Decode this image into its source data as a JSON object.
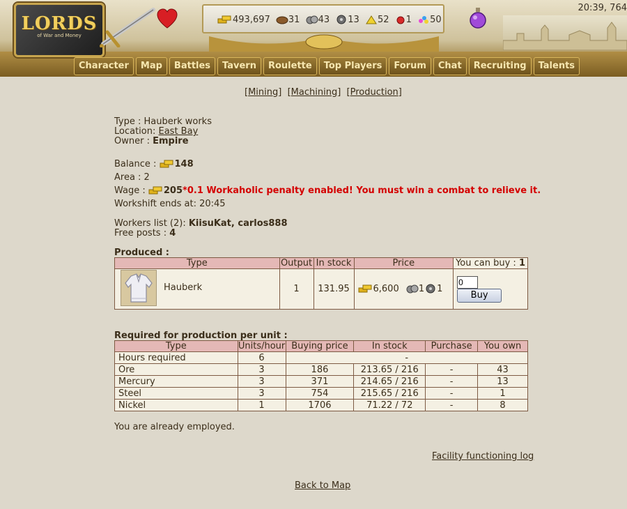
{
  "header": {
    "logo_title": "LORDS",
    "logo_subtitle": "of War and Money",
    "resources": [
      {
        "icon": "gold-icon",
        "value": "493,697"
      },
      {
        "icon": "wood-icon",
        "value": "31"
      },
      {
        "icon": "ore-icon",
        "value": "43"
      },
      {
        "icon": "mercury-icon",
        "value": "13"
      },
      {
        "icon": "sulfur-icon",
        "value": "52"
      },
      {
        "icon": "crystal-icon",
        "value": "1"
      },
      {
        "icon": "gems-icon",
        "value": "50"
      }
    ],
    "clock": "20:39, 764"
  },
  "nav": [
    "Character",
    "Map",
    "Battles",
    "Tavern",
    "Roulette",
    "Top Players",
    "Forum",
    "Chat",
    "Recruiting",
    "Talents"
  ],
  "subnav": [
    "Mining",
    "Machining",
    "Production"
  ],
  "facility": {
    "type_label": "Type : ",
    "type_value": "Hauberk works",
    "location_label": "Location: ",
    "location_value": "East Bay",
    "owner_label": "Owner : ",
    "owner_value": "Empire",
    "balance_label": "Balance : ",
    "balance_value": "148",
    "area_text": "Area : 2",
    "wage_label": "Wage : ",
    "wage_value": "205",
    "wage_penalty": "*0.1 Workaholic penalty enabled! You must win a combat to relieve it.",
    "workshift_text": "Workshift ends at: 20:45",
    "workers_label": "Workers list (2): ",
    "workers_value": "KiisuKat, carlos888",
    "free_posts_label": "Free posts : ",
    "free_posts_value": "4"
  },
  "produced": {
    "heading": "Produced :",
    "headers": {
      "type": "Type",
      "output": "Output",
      "in_stock": "In stock",
      "price": "Price",
      "can_buy": "You can buy : ",
      "can_buy_value": "1"
    },
    "row": {
      "name": "Hauberk",
      "output": "1",
      "in_stock": "131.95",
      "price_gold": "6,600",
      "price_ore": "1",
      "price_mercury": "1",
      "qty": "0",
      "buy_label": "Buy"
    }
  },
  "required": {
    "heading": "Required for production per unit :",
    "headers": [
      "Type",
      "Units/hour",
      "Buying price",
      "In stock",
      "Purchase",
      "You own"
    ],
    "hours_label": "Hours required",
    "hours_value": "6",
    "hours_dash": "-",
    "rows": [
      {
        "type": "Ore",
        "units": "3",
        "price": "186",
        "stock": "213.65 / 216",
        "purchase": "-",
        "own": "43"
      },
      {
        "type": "Mercury",
        "units": "3",
        "price": "371",
        "stock": "214.65 / 216",
        "purchase": "-",
        "own": "13"
      },
      {
        "type": "Steel",
        "units": "3",
        "price": "754",
        "stock": "215.65 / 216",
        "purchase": "-",
        "own": "1"
      },
      {
        "type": "Nickel",
        "units": "1",
        "price": "1706",
        "stock": "71.22 / 72",
        "purchase": "-",
        "own": "8"
      }
    ]
  },
  "employed_text": "You are already employed.",
  "log_link": "Facility functioning log",
  "back_link": "Back to Map"
}
